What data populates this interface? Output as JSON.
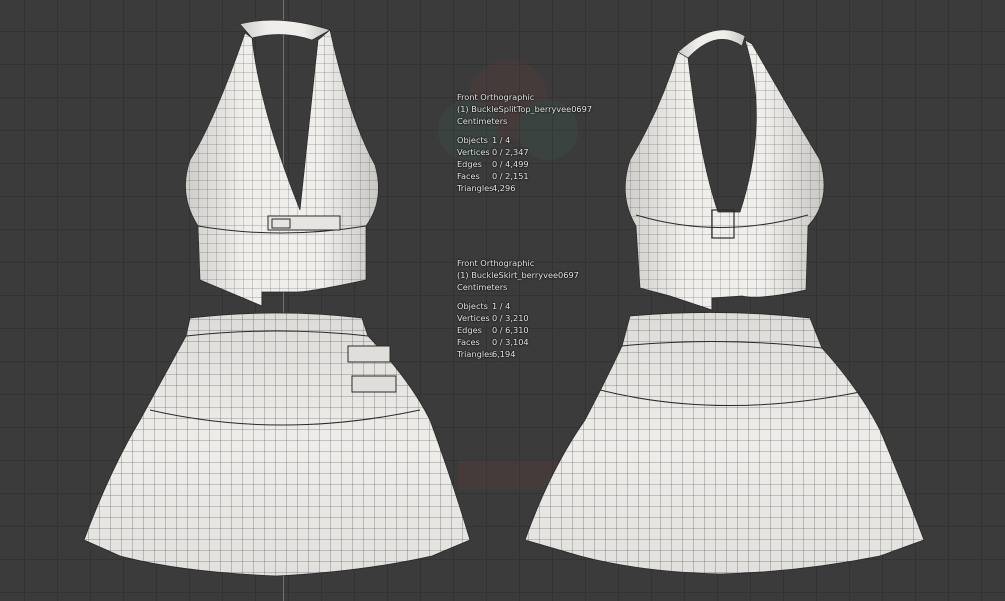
{
  "viewport": {
    "background_color": "#3b3b3b",
    "grid_color": "#333333",
    "axis_color": "#5d7fb8",
    "mesh_fill": "#e9e7e4",
    "mesh_wire": "#2a2a2a"
  },
  "overlays": [
    {
      "view": "Front Orthographic",
      "object": "(1) BuckleSplitTop_berryvee0697",
      "units": "Centimeters",
      "stats": [
        {
          "label": "Objects",
          "value": "1 / 4"
        },
        {
          "label": "Vertices",
          "value": "0 / 2,347"
        },
        {
          "label": "Edges",
          "value": "0 / 4,499"
        },
        {
          "label": "Faces",
          "value": "0 / 2,151"
        },
        {
          "label": "Triangles",
          "value": "4,296"
        }
      ]
    },
    {
      "view": "Front Orthographic",
      "object": "(1) BuckleSkirt_berryvee0697",
      "units": "Centimeters",
      "stats": [
        {
          "label": "Objects",
          "value": "1 / 4"
        },
        {
          "label": "Vertices",
          "value": "0 / 3,210"
        },
        {
          "label": "Edges",
          "value": "0 / 6,310"
        },
        {
          "label": "Faces",
          "value": "0 / 3,104"
        },
        {
          "label": "Triangles",
          "value": "6,194"
        }
      ]
    }
  ]
}
